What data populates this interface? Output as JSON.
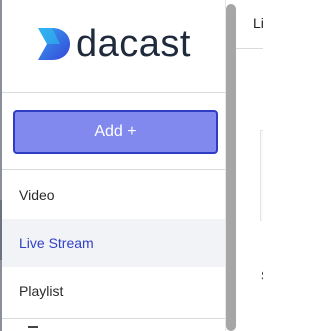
{
  "brand": {
    "name": "dacast",
    "logo_icon": "dacast-logo-icon",
    "accent": "#8188ee",
    "accent_border": "#2f3cc4",
    "active_text": "#3140c8"
  },
  "sidebar": {
    "add_button_label": "Add +",
    "items": [
      {
        "label": "Video",
        "active": false
      },
      {
        "label": "Live Stream",
        "active": true
      },
      {
        "label": "Playlist",
        "active": false
      }
    ]
  },
  "main": {
    "tab_label": "Li",
    "side_glyph": "S"
  }
}
